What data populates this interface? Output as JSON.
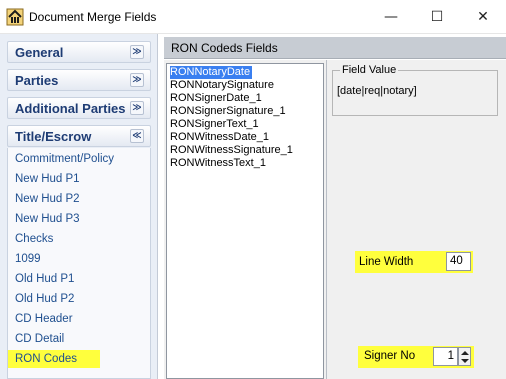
{
  "window": {
    "title": "Document Merge Fields",
    "minimize": "—",
    "maximize": "☐",
    "close": "✕"
  },
  "nav": {
    "groups": [
      {
        "label": "General",
        "chevron": "≫",
        "expanded": false
      },
      {
        "label": "Parties",
        "chevron": "≫",
        "expanded": false
      },
      {
        "label": "Additional Parties",
        "chevron": "≫",
        "expanded": false
      },
      {
        "label": "Title/Escrow",
        "chevron": "≪",
        "expanded": true
      }
    ],
    "items": [
      "Commitment/Policy",
      "New Hud P1",
      "New Hud P2",
      "New Hud P3",
      "Checks",
      "1099",
      "Old Hud P1",
      "Old Hud P2",
      "CD Header",
      "CD Detail",
      "RON Codes"
    ],
    "selected_item": "RON Codes"
  },
  "main": {
    "header": "RON Codeds Fields",
    "fields": [
      "RONNotaryDate",
      "RONNotarySignature",
      "RONSignerDate_1",
      "RONSignerSignature_1",
      "RONSignerText_1",
      "RONWitnessDate_1",
      "RONWitnessSignature_1",
      "RONWitnessText_1"
    ],
    "selected_field": "RONNotaryDate"
  },
  "properties": {
    "field_value_legend": "Field Value",
    "field_value": "[date|req|notary]",
    "line_width_label": "Line Width",
    "line_width_value": "40",
    "signer_no_label": "Signer No",
    "signer_no_value": "1"
  },
  "colors": {
    "highlight": "#ffff3d",
    "selection": "#3a7ff0",
    "nav_header_text": "#1e3c74",
    "nav_link_text": "#1f4f8f"
  }
}
